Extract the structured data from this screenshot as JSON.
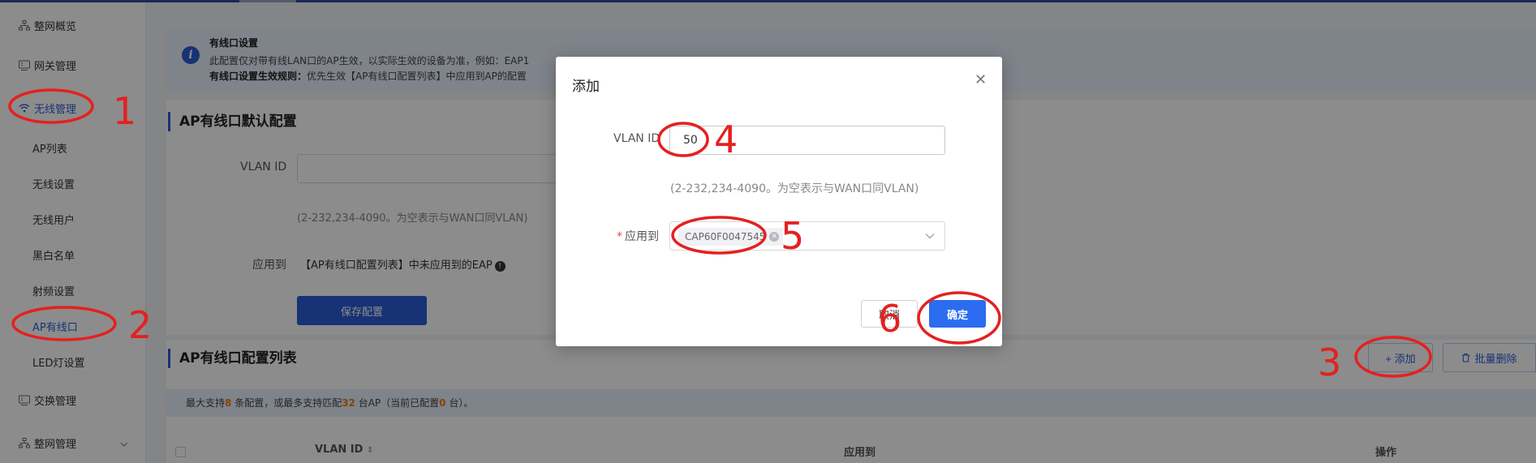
{
  "sidebar": {
    "items": [
      {
        "label": "整网概览",
        "icon": "network-icon"
      },
      {
        "label": "网关管理",
        "icon": "gateway-icon"
      },
      {
        "label": "无线管理",
        "icon": "wifi-icon",
        "active": true
      },
      {
        "label": "AP列表"
      },
      {
        "label": "无线设置"
      },
      {
        "label": "无线用户"
      },
      {
        "label": "黑白名单"
      },
      {
        "label": "射频设置"
      },
      {
        "label": "AP有线口",
        "active": true
      },
      {
        "label": "LED灯设置"
      },
      {
        "label": "交换管理",
        "icon": "switch-icon"
      },
      {
        "label": "整网管理",
        "icon": "manage-icon"
      }
    ]
  },
  "info": {
    "title": "有线口设置",
    "line1": "此配置仅对带有线LAN口的AP生效，以实际生效的设备为准，例如：EAP1",
    "line2_bold": "有线口设置生效规则：",
    "line2_rest": "优先生效【AP有线口配置列表】中应用到AP的配置"
  },
  "default_section": {
    "title": "AP有线口默认配置",
    "vlan_label": "VLAN ID",
    "hint": "(2-232,234-4090。为空表示与WAN口同VLAN)",
    "apply_label": "应用到",
    "apply_text": "【AP有线口配置列表】中未应用到的EAP",
    "save_label": "保存配置"
  },
  "list_section": {
    "title": "AP有线口配置列表",
    "add_label": "+ 添加",
    "batch_delete_label": "批量删除",
    "limit_prefix": "最大支持",
    "limit_count": "8",
    "limit_mid": " 条配置，或最多支持匹配",
    "limit_ap": "32",
    "limit_mid2": " 台AP（当前已配置",
    "limit_current": "0",
    "limit_suffix": " 台）。",
    "columns": [
      "VLAN ID",
      "应用到",
      "操作"
    ]
  },
  "modal": {
    "title": "添加",
    "vlan_label": "VLAN ID",
    "vlan_value": "50",
    "hint": "(2-232,234-4090。为空表示与WAN口同VLAN)",
    "apply_label": "应用到",
    "tag": "CAP60F0047545",
    "cancel_label": "取消",
    "ok_label": "确定"
  },
  "annotations": [
    "1",
    "2",
    "3",
    "4",
    "5",
    "6"
  ],
  "colors": {
    "accent": "#2b5cd6",
    "annotation": "#e52020",
    "orange": "#f07c00"
  }
}
